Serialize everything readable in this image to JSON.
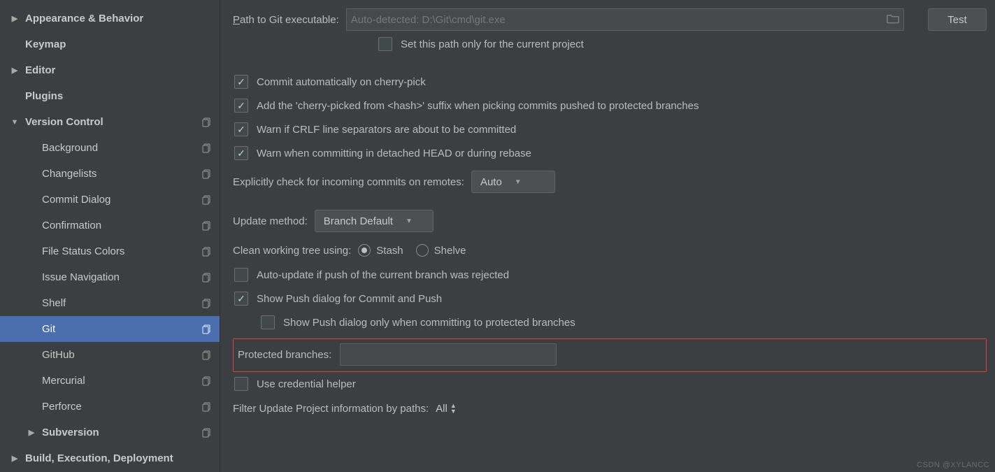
{
  "sidebar": {
    "items": [
      {
        "label": "Appearance & Behavior",
        "level": 0,
        "expandable": true,
        "expanded": false,
        "copy": false
      },
      {
        "label": "Keymap",
        "level": 0,
        "expandable": false,
        "copy": false
      },
      {
        "label": "Editor",
        "level": 0,
        "expandable": true,
        "expanded": false,
        "copy": false
      },
      {
        "label": "Plugins",
        "level": 0,
        "expandable": false,
        "copy": false
      },
      {
        "label": "Version Control",
        "level": 0,
        "expandable": true,
        "expanded": true,
        "copy": true
      },
      {
        "label": "Background",
        "level": 1,
        "copy": true
      },
      {
        "label": "Changelists",
        "level": 1,
        "copy": true
      },
      {
        "label": "Commit Dialog",
        "level": 1,
        "copy": true
      },
      {
        "label": "Confirmation",
        "level": 1,
        "copy": true
      },
      {
        "label": "File Status Colors",
        "level": 1,
        "copy": true
      },
      {
        "label": "Issue Navigation",
        "level": 1,
        "copy": true
      },
      {
        "label": "Shelf",
        "level": 1,
        "copy": true
      },
      {
        "label": "Git",
        "level": 1,
        "copy": true,
        "selected": true
      },
      {
        "label": "GitHub",
        "level": 1,
        "copy": true
      },
      {
        "label": "Mercurial",
        "level": 1,
        "copy": true
      },
      {
        "label": "Perforce",
        "level": 1,
        "copy": true
      },
      {
        "label": "Subversion",
        "level": 0,
        "expandable": true,
        "expanded": false,
        "indent_as_child": true,
        "copy": true
      },
      {
        "label": "Build, Execution, Deployment",
        "level": 0,
        "expandable": true,
        "expanded": false,
        "copy": false
      }
    ]
  },
  "form": {
    "path_label_prefix": "P",
    "path_label_rest": "ath to Git executable:",
    "path_placeholder": "Auto-detected: D:\\Git\\cmd\\git.exe",
    "test_button": "Test",
    "set_path_current_project": "Set this path only for the current project",
    "chk_cherry_pick": "Commit automatically on cherry-pick",
    "chk_cherry_suffix": "Add the 'cherry-picked from <hash>' suffix when picking commits pushed to protected branches",
    "chk_crlf": "Warn if CRLF line separators are about to be committed",
    "chk_detached": "Warn when committing in detached HEAD or during rebase",
    "explicit_check_label": "Explicitly check for incoming commits on remotes:",
    "explicit_check_value": "Auto",
    "update_method_label": "Update method:",
    "update_method_value": "Branch Default",
    "clean_tree_label": "Clean working tree using:",
    "clean_tree_opt_stash": "Stash",
    "clean_tree_opt_shelve": "Shelve",
    "chk_auto_update_push": "Auto-update if push of the current branch was rejected",
    "chk_show_push": "Show Push dialog for Commit and Push",
    "chk_show_push_protected": "Show Push dialog only when committing to protected branches",
    "protected_label": "Protected branches:",
    "protected_value": "",
    "chk_credential": "Use credential helper",
    "filter_label": "Filter Update Project information by paths:",
    "filter_value": "All"
  },
  "watermark": "CSDN @XYLANCC"
}
